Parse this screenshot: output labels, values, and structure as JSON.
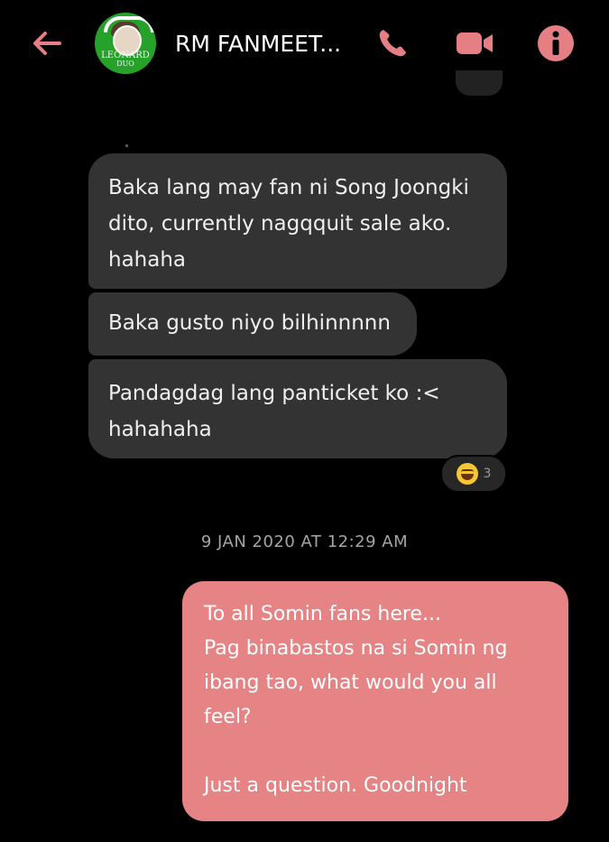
{
  "header": {
    "title": "RM FANMEET...",
    "avatar_text": "LEONARD",
    "avatar_text_small": "DUO"
  },
  "colors": {
    "accent": "#e57f83",
    "background": "#000000",
    "incoming_bubble": "#333333",
    "outgoing_bubble": "#e58385"
  },
  "icons": {
    "back": "back-arrow-icon",
    "call": "phone-icon",
    "video": "video-camera-icon",
    "info": "info-icon"
  },
  "messages": {
    "incoming": [
      {
        "lines": [
          "Baka lang may fan ni Song Joongki",
          "dito, currently nagqquit sale ako.",
          "hahaha"
        ]
      },
      {
        "lines": [
          "Baka gusto niyo bilhinnnnn"
        ]
      },
      {
        "lines": [
          "Pandagdag lang panticket ko :<",
          "hahahaha"
        ],
        "reaction": {
          "emoji": "laughing-emoji",
          "count": "3"
        }
      }
    ],
    "timestamp": "9 JAN 2020 AT 12:29 AM",
    "outgoing": {
      "lines": [
        "To all Somin fans here...",
        "Pag binabastos na si Somin ng",
        "ibang tao, what would you all",
        "feel?"
      ],
      "closing": "Just a question. Goodnight"
    }
  }
}
